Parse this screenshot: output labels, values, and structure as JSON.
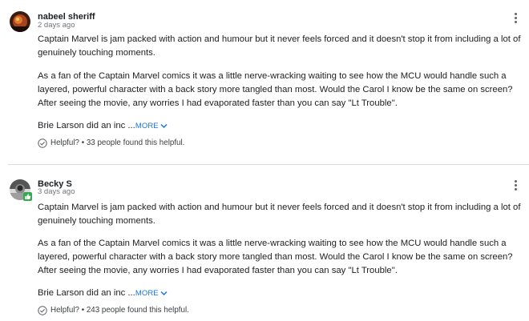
{
  "reviews": [
    {
      "author": "nabeel sheriff",
      "date": "2 days ago",
      "paragraphs": [
        "Captain Marvel is jam packed with action and humour but it never feels forced and it doesn't stop it from including a lot of genuinely touching moments.",
        "As a fan of the Captain Marvel comics it was a little nerve-wracking waiting to see how the MCU would handle such a layered, powerful character with a back story more tangled than most. Would the Carol I know be the same on screen? After seeing the movie, any worries I had evaporated faster than you can say \"Lt Trouble\"."
      ],
      "truncated": "Brie Larson did an inc ...",
      "more_label": "MORE",
      "helpful_label": "Helpful?",
      "helpful_count": "• 33 people found this helpful.",
      "avatar_icon": "user-photo-dark"
    },
    {
      "author": "Becky S",
      "date": "3 days ago",
      "paragraphs": [
        "Captain Marvel is jam packed with action and humour but it never feels forced and it doesn't stop it from including a lot of genuinely touching moments.",
        "As a fan of the Captain Marvel comics it was a little nerve-wracking waiting to see how the MCU would handle such a layered, powerful character with a back story more tangled than most. Would the Carol I know be the same on screen? After seeing the movie, any worries I had evaporated faster than you can say \"Lt Trouble\"."
      ],
      "truncated": "Brie Larson did an inc ...",
      "more_label": "MORE",
      "helpful_label": "Helpful?",
      "helpful_count": "• 243 people found this helpful.",
      "avatar_icon": "user-photo-grey",
      "badge_icon": "thumbs-up-badge-icon"
    }
  ],
  "colors": {
    "link": "#1a73e8",
    "badge": "#34a853",
    "divider": "#dadce0"
  }
}
